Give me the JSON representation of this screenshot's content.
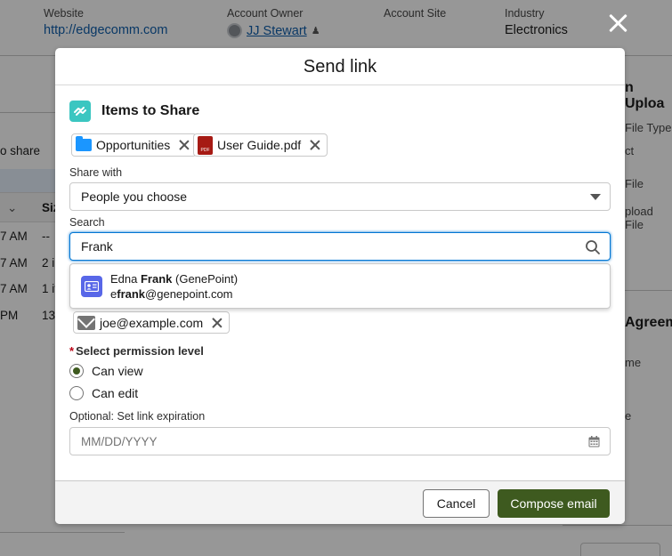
{
  "background": {
    "fields": [
      {
        "label": "Website",
        "value": "http://edgecomm.com"
      },
      {
        "label": "Account Owner",
        "value": "JJ Stewart"
      },
      {
        "label": "Account Site",
        "value": ""
      },
      {
        "label": "Industry",
        "value": "Electronics"
      }
    ],
    "left": {
      "share_text": "o share",
      "col_head": "Siz",
      "rows": [
        {
          "time": "7 AM",
          "size": "--"
        },
        {
          "time": "7 AM",
          "size": "2 i"
        },
        {
          "time": "7 AM",
          "size": "1 it"
        },
        {
          "time": "PM",
          "size": "13"
        }
      ]
    },
    "right": {
      "title1": "n Uploa",
      "lines1": [
        "File Type",
        "ct",
        "File",
        "pload File"
      ],
      "title2": "Agreem",
      "lines2": [
        "me",
        "e"
      ]
    }
  },
  "modal": {
    "title": "Send link",
    "section_title": "Items to Share",
    "items": [
      {
        "label": "Opportunities",
        "icon": "folder-icon"
      },
      {
        "label": "User Guide.pdf",
        "icon": "pdf-icon"
      }
    ],
    "share_with": {
      "label": "Share with",
      "value": "People you choose"
    },
    "search": {
      "label": "Search",
      "value": "Frank"
    },
    "suggestion": {
      "name_prefix": "Edna ",
      "name_match": "Frank",
      "name_suffix": " (GenePoint)",
      "email_prefix": "e",
      "email_match": "frank",
      "email_suffix": "@genepoint.com"
    },
    "recipients": [
      "joe@example.com"
    ],
    "permission": {
      "label": "Select permission level",
      "options": [
        {
          "label": "Can view",
          "checked": true
        },
        {
          "label": "Can edit",
          "checked": false
        }
      ]
    },
    "expiration": {
      "label": "Optional: Set link expiration",
      "placeholder": "MM/DD/YYYY"
    },
    "buttons": {
      "cancel": "Cancel",
      "primary": "Compose email"
    }
  },
  "colors": {
    "brand_primary": "#3e5a1f",
    "focus_blue": "#0176d3",
    "share_icon": "#3bc6c1",
    "contact_icon": "#5867e8",
    "required": "#ba0517"
  }
}
